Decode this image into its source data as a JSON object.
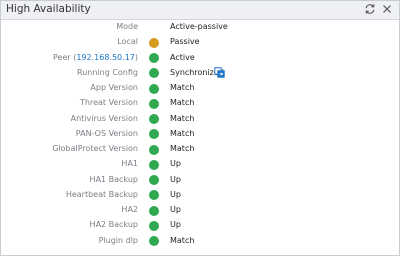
{
  "widget": {
    "title": "High Availability",
    "icons": {
      "refresh": "refresh-icon",
      "close": "close-icon"
    }
  },
  "colors": {
    "green": "#2fa84f",
    "amber": "#d49a1c",
    "link": "#1c73c9"
  },
  "rows": [
    {
      "label": "Mode",
      "value": "Active-passive",
      "status": "none"
    },
    {
      "label": "Local",
      "value": "Passive",
      "status": "amber"
    },
    {
      "label": "Peer",
      "peer_ip": "192.168.50.17",
      "value": "Active",
      "status": "green"
    },
    {
      "label": "Running Config",
      "value": "Synchronized",
      "status": "green",
      "icon": "copy-config-icon"
    },
    {
      "label": "App Version",
      "value": "Match",
      "status": "green"
    },
    {
      "label": "Threat Version",
      "value": "Match",
      "status": "green"
    },
    {
      "label": "Antivirus Version",
      "value": "Match",
      "status": "green"
    },
    {
      "label": "PAN-OS Version",
      "value": "Match",
      "status": "green"
    },
    {
      "label": "GlobalProtect Version",
      "value": "Match",
      "status": "green"
    },
    {
      "label": "HA1",
      "value": "Up",
      "status": "green"
    },
    {
      "label": "HA1 Backup",
      "value": "Up",
      "status": "green"
    },
    {
      "label": "Heartbeat Backup",
      "value": "Up",
      "status": "green"
    },
    {
      "label": "HA2",
      "value": "Up",
      "status": "green"
    },
    {
      "label": "HA2 Backup",
      "value": "Up",
      "status": "green"
    },
    {
      "label": "Plugin dlp",
      "value": "Match",
      "status": "green"
    }
  ]
}
